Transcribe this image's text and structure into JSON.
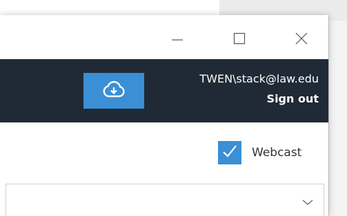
{
  "colors": {
    "header_bg": "#1f2a36",
    "accent": "#3b8fd4",
    "window_bg": "#ffffff"
  },
  "window_controls": {
    "minimize_icon": "minimize-icon",
    "maximize_icon": "maximize-icon",
    "close_icon": "close-icon"
  },
  "header": {
    "upload_icon": "cloud-download-icon",
    "account_email": "TWEN\\stack@law.edu",
    "sign_out_label": "Sign out"
  },
  "options": {
    "webcast_label": "Webcast",
    "webcast_checked": true
  },
  "dropdown": {
    "selected_value": "",
    "icon": "chevron-down-icon"
  }
}
